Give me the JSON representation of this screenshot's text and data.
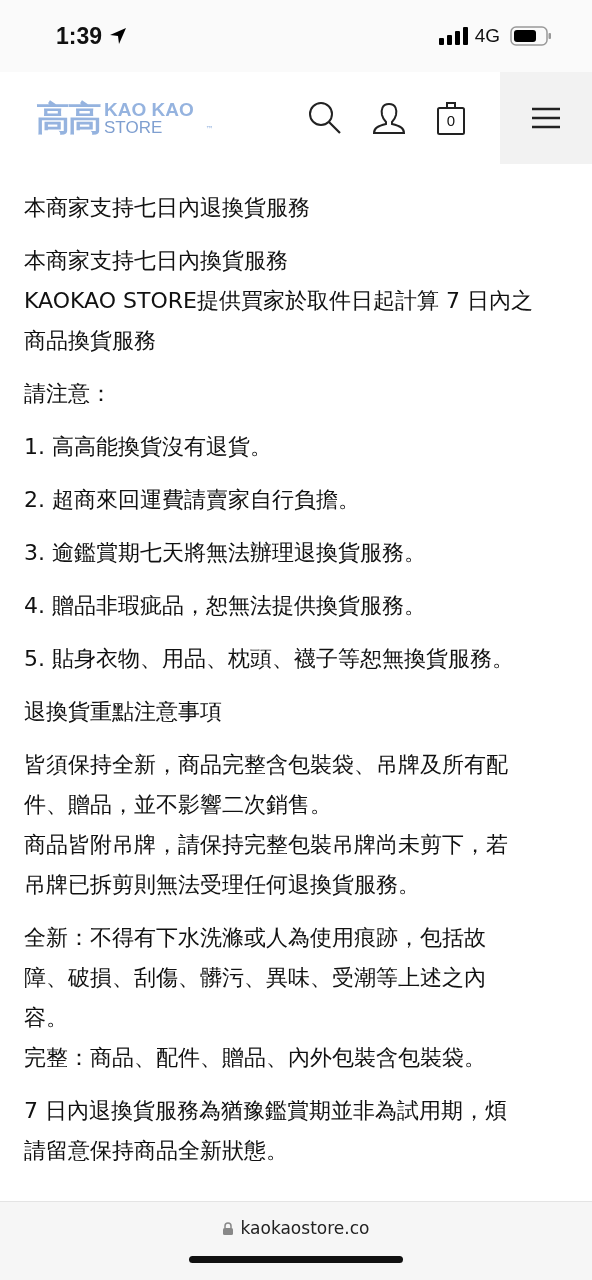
{
  "status_bar": {
    "time": "1:39",
    "network": "4G"
  },
  "header": {
    "logo": {
      "chinese": "高高",
      "brand": "KAO KAO",
      "sub": "STORE",
      "mark": "™"
    },
    "cart_count": "0"
  },
  "content": [
    {
      "lines": [
        "本商家支持七日內退換貨服務"
      ]
    },
    {
      "lines": [
        "本商家支持七日內換貨服務",
        "KAOKAO STORE提供買家於取件日起計算 7 日內之",
        "商品換貨服務"
      ]
    },
    {
      "lines": [
        "請注意："
      ]
    },
    {
      "lines": [
        "1. 高高能換貨沒有退貨。"
      ]
    },
    {
      "lines": [
        "2. 超商來回運費請賣家自行負擔。"
      ]
    },
    {
      "lines": [
        "3. 逾鑑賞期七天將無法辦理退換貨服務。"
      ]
    },
    {
      "lines": [
        "4. 贈品非瑕疵品，恕無法提供換貨服務。"
      ]
    },
    {
      "lines": [
        "5. 貼身衣物、用品、枕頭、襪子等恕無換貨服務。"
      ]
    },
    {
      "lines": [
        "退換貨重點注意事項"
      ]
    },
    {
      "lines": [
        "皆須保持全新，商品完整含包裝袋、吊牌及所有配",
        "件、贈品，並不影響二次銷售。",
        "商品皆附吊牌，請保持完整包裝吊牌尚未剪下，若",
        "吊牌已拆剪則無法受理任何退換貨服務。"
      ]
    },
    {
      "lines": [
        "全新：不得有下水洗滌或人為使用痕跡，包括故",
        "障、破損、刮傷、髒污、異味、受潮等上述之內",
        "容。",
        "完整：商品、配件、贈品、內外包裝含包裝袋。"
      ]
    },
    {
      "lines": [
        "7 日內退換貨服務為猶豫鑑賞期並非為試用期，煩",
        "請留意保持商品全新狀態。"
      ]
    }
  ],
  "address_bar": {
    "url": "kaokaostore.co"
  }
}
